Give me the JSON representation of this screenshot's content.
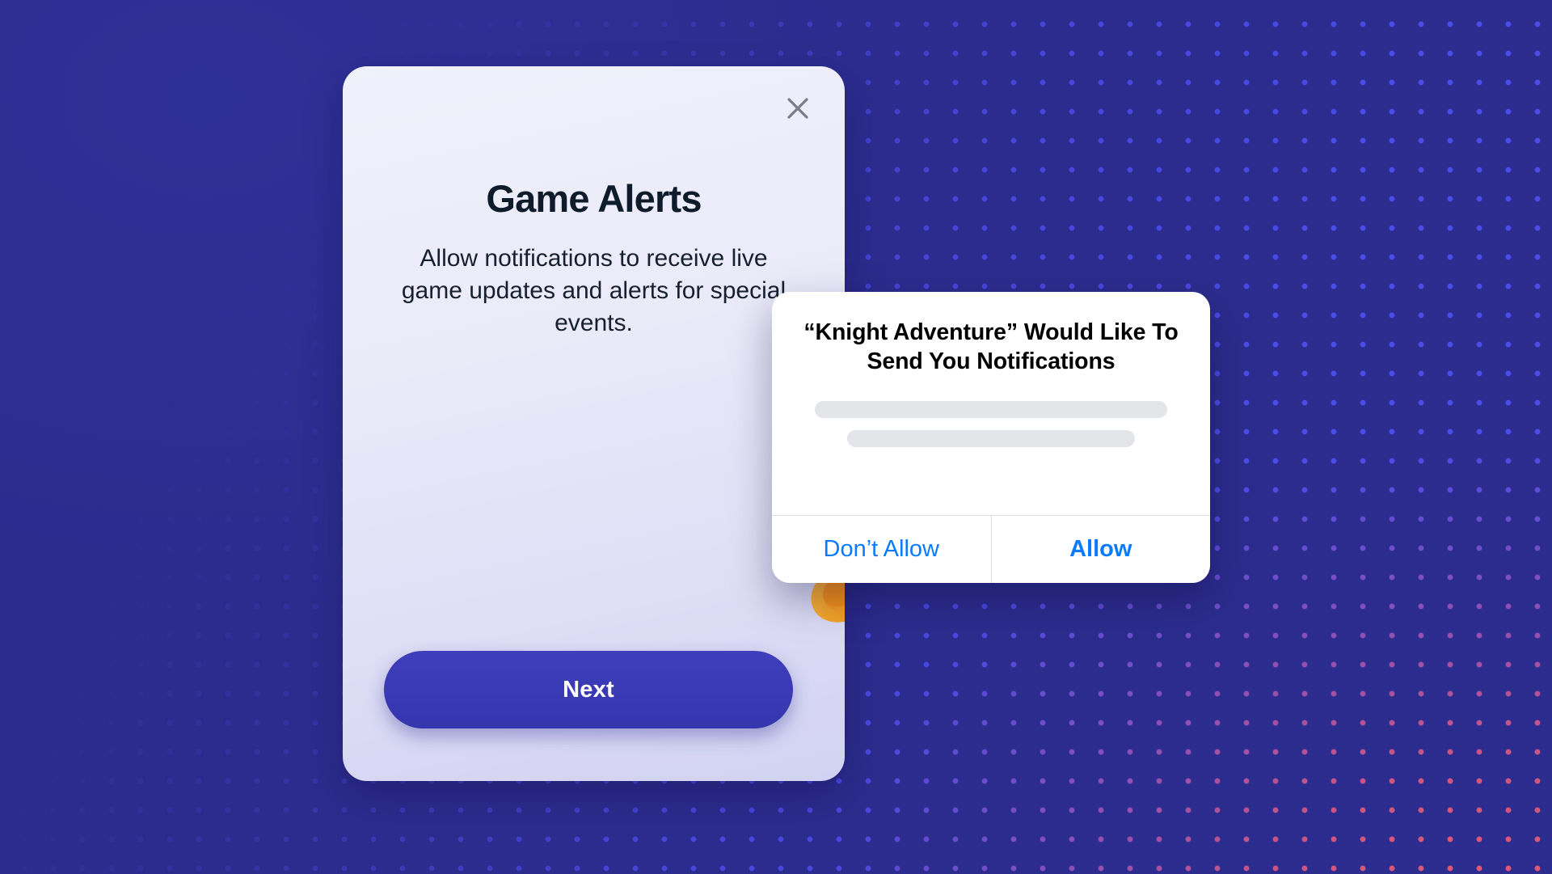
{
  "background": {
    "base_color": "#2C2C8E",
    "dot_color_start": "#4A4AE8",
    "dot_color_end": "#E8566B",
    "dot_spacing_px": 36
  },
  "onboarding_card": {
    "close_icon": "close-x-icon",
    "title": "Game Alerts",
    "subtitle": "Allow notifications to receive live game updates and alerts for special events.",
    "illustration": "sword-icon",
    "primary_button": {
      "label": "Next",
      "background": "#3A3AB5",
      "text_color": "#FFFFFF"
    },
    "card_gradient_start": "#F1F1FC",
    "card_gradient_end": "#D2D2F2"
  },
  "ios_permission_dialog": {
    "title": "“Knight Adventure” Would Like To Send You Notifications",
    "body_placeholder_lines": 2,
    "actions": {
      "deny_label": "Don’t Allow",
      "allow_label": "Allow",
      "accent_color": "#0A7BFF"
    }
  }
}
